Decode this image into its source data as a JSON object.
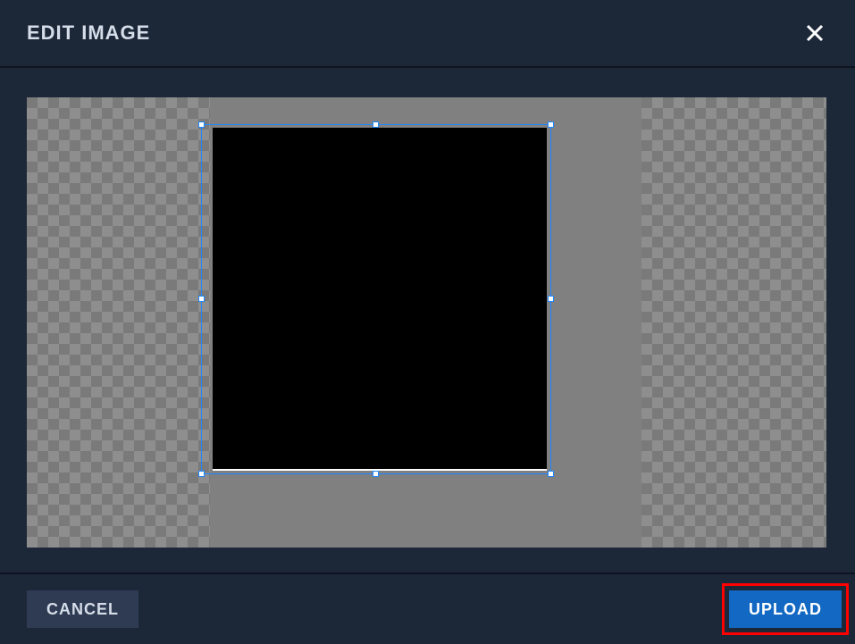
{
  "header": {
    "title": "EDIT IMAGE"
  },
  "footer": {
    "cancel_label": "CANCEL",
    "upload_label": "UPLOAD"
  }
}
